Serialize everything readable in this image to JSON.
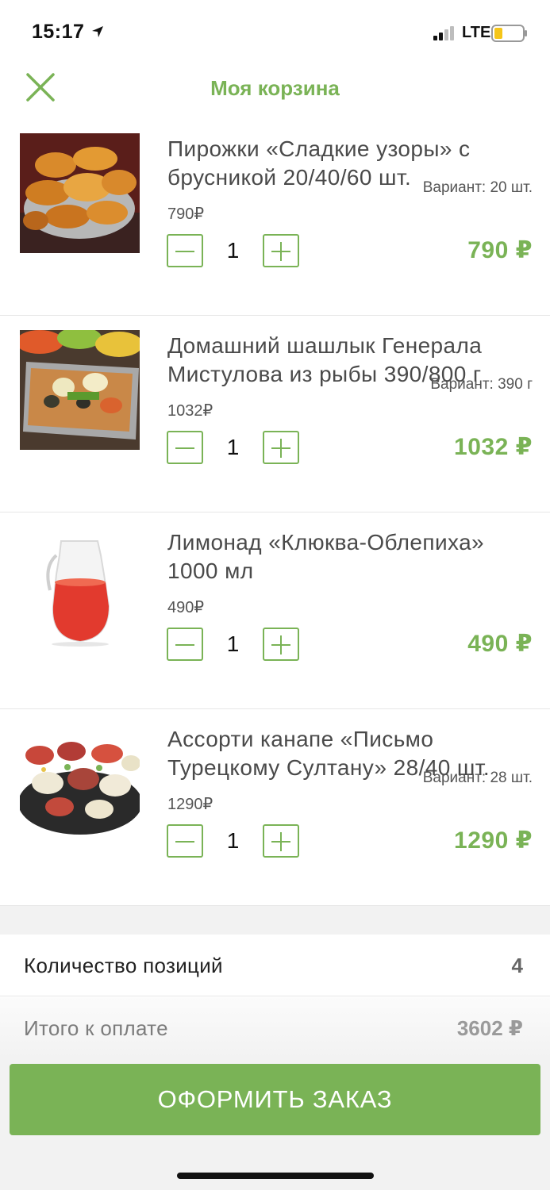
{
  "status_bar": {
    "time": "15:17",
    "network": "LTE",
    "icons": [
      "location-arrow-icon",
      "cellular-signal-icon",
      "battery-low-icon"
    ]
  },
  "header": {
    "title": "Моя корзина",
    "close_icon": "close-icon"
  },
  "colors": {
    "accent": "#7ab356",
    "text": "#4a4a4a",
    "divider": "#e6e6e6"
  },
  "items": [
    {
      "title": "Пирожки «Сладкие узоры» с брусникой 20/40/60 шт.",
      "variant": "Вариант: 20 шт.",
      "unit_price": "790₽",
      "quantity": "1",
      "total": "790 ₽",
      "image": "pirozhki-photo"
    },
    {
      "title": "Домашний шашлык Генерала Мистулова из рыбы 390/800 г",
      "variant": "Вариант: 390 г",
      "unit_price": "1032₽",
      "quantity": "1",
      "total": "1032 ₽",
      "image": "fish-shashlik-photo"
    },
    {
      "title": "Лимонад «Клюква-Облепиха» 1000 мл",
      "variant": "",
      "unit_price": "490₽",
      "quantity": "1",
      "total": "490 ₽",
      "image": "lemonade-jug-photo"
    },
    {
      "title": "Ассорти канапе «Письмо Турецкому Султану» 28/40 шт.",
      "variant": "Вариант: 28 шт.",
      "unit_price": "1290₽",
      "quantity": "1",
      "total": "1290 ₽",
      "image": "canape-platter-photo"
    }
  ],
  "summary": {
    "count_label": "Количество позиций",
    "count_value": "4",
    "total_label": "Итого к оплате",
    "total_value": "3602 ₽"
  },
  "checkout": {
    "label": "ОФОРМИТЬ ЗАКАЗ"
  }
}
